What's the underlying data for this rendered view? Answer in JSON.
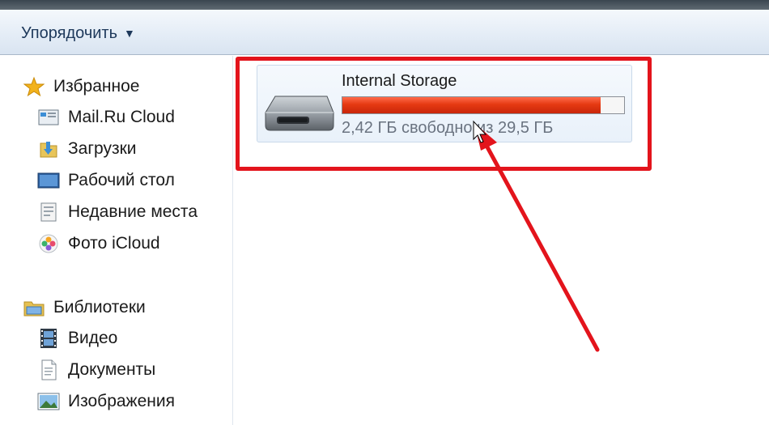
{
  "toolbar": {
    "organize_label": "Упорядочить",
    "organize_arrow": "▼"
  },
  "sidebar": {
    "favorites": {
      "label": "Избранное",
      "icon": "star-icon",
      "items": [
        {
          "label": "Mail.Ru Cloud",
          "icon": "cloud-window-icon"
        },
        {
          "label": "Загрузки",
          "icon": "downloads-folder-icon"
        },
        {
          "label": "Рабочий стол",
          "icon": "desktop-icon"
        },
        {
          "label": "Недавние места",
          "icon": "recent-places-icon"
        },
        {
          "label": "Фото iCloud",
          "icon": "icloud-photos-icon"
        }
      ]
    },
    "libraries": {
      "label": "Библиотеки",
      "icon": "libraries-folder-icon",
      "items": [
        {
          "label": "Видео",
          "icon": "video-library-icon"
        },
        {
          "label": "Документы",
          "icon": "documents-library-icon"
        },
        {
          "label": "Изображения",
          "icon": "pictures-library-icon"
        }
      ]
    }
  },
  "drive": {
    "name": "Internal Storage",
    "free_text": "2,42 ГБ свободно из 29,5 ГБ",
    "used_fraction": 0.918,
    "icon": "removable-drive-icon",
    "bar_color": "#e53a12"
  },
  "annotation": {
    "color": "#e3141c"
  }
}
